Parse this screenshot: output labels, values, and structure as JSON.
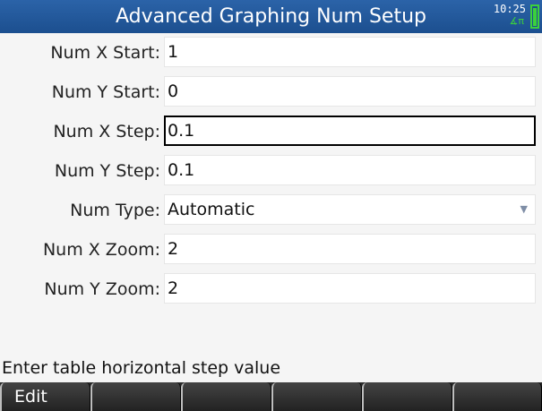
{
  "title": "Advanced Graphing Num Setup",
  "status": {
    "time": "10:25",
    "angle_mode": "∡π"
  },
  "fields": [
    {
      "label": "Num X Start:",
      "value": "1"
    },
    {
      "label": "Num Y Start:",
      "value": "0"
    },
    {
      "label": "Num X Step:",
      "value": "0.1"
    },
    {
      "label": "Num Y Step:",
      "value": "0.1"
    },
    {
      "label": "Num Type:",
      "value": "Automatic"
    },
    {
      "label": "Num X Zoom:",
      "value": "2"
    },
    {
      "label": "Num Y Zoom:",
      "value": "2"
    }
  ],
  "hint": "Enter table horizontal step value",
  "menu": [
    "Edit",
    "",
    "",
    "",
    "",
    ""
  ],
  "colors": {
    "titlebar": "#1c4f8f",
    "battery": "#3cd13c"
  }
}
